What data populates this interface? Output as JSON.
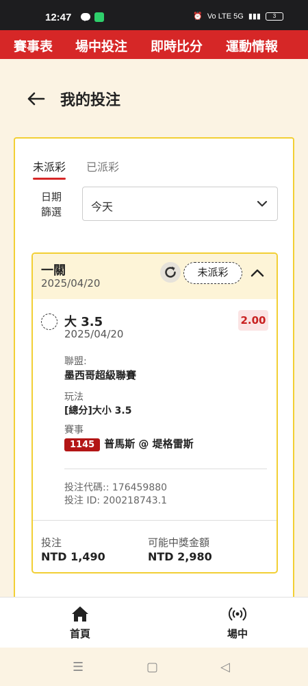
{
  "status_bar": {
    "time": "12:47",
    "network": "Vo LTE  5G",
    "battery": "3"
  },
  "top_nav": {
    "items": [
      "賽事表",
      "場中投注",
      "即時比分",
      "運動情報"
    ]
  },
  "page": {
    "title": "我的投注",
    "back_icon": "arrow-left-icon"
  },
  "tabs": [
    {
      "label": "未派彩",
      "active": true
    },
    {
      "label": "已派彩",
      "active": false
    }
  ],
  "filter": {
    "label_line1": "日期",
    "label_line2": "篩選",
    "value": "今天"
  },
  "bet": {
    "type": "一關",
    "date": "2025/04/20",
    "status": "未派彩",
    "selection": {
      "name": "大 3.5",
      "date": "2025/04/20",
      "odds": "2.00"
    },
    "league_label": "聯盟:",
    "league": "墨西哥超級聯賽",
    "market_label": "玩法",
    "market": "[總分]大小 3.5",
    "event_label": "賽事",
    "match_id": "1145",
    "match": "普馬斯 @ 堤格雷斯",
    "bet_code": "投注代碼:: 176459880",
    "bet_id": "投注 ID: 200218743.1",
    "stake_label": "投注",
    "stake": "NTD 1,490",
    "payout_label": "可能中獎金額",
    "payout": "NTD 2,980"
  },
  "bottom_tabs": [
    {
      "label": "首頁",
      "icon": "home-icon"
    },
    {
      "label": "場中",
      "icon": "live-broadcast-icon"
    }
  ],
  "colors": {
    "brand_red": "#d62727",
    "accent_yellow": "#f2cf34",
    "background": "#fbf3e3"
  }
}
